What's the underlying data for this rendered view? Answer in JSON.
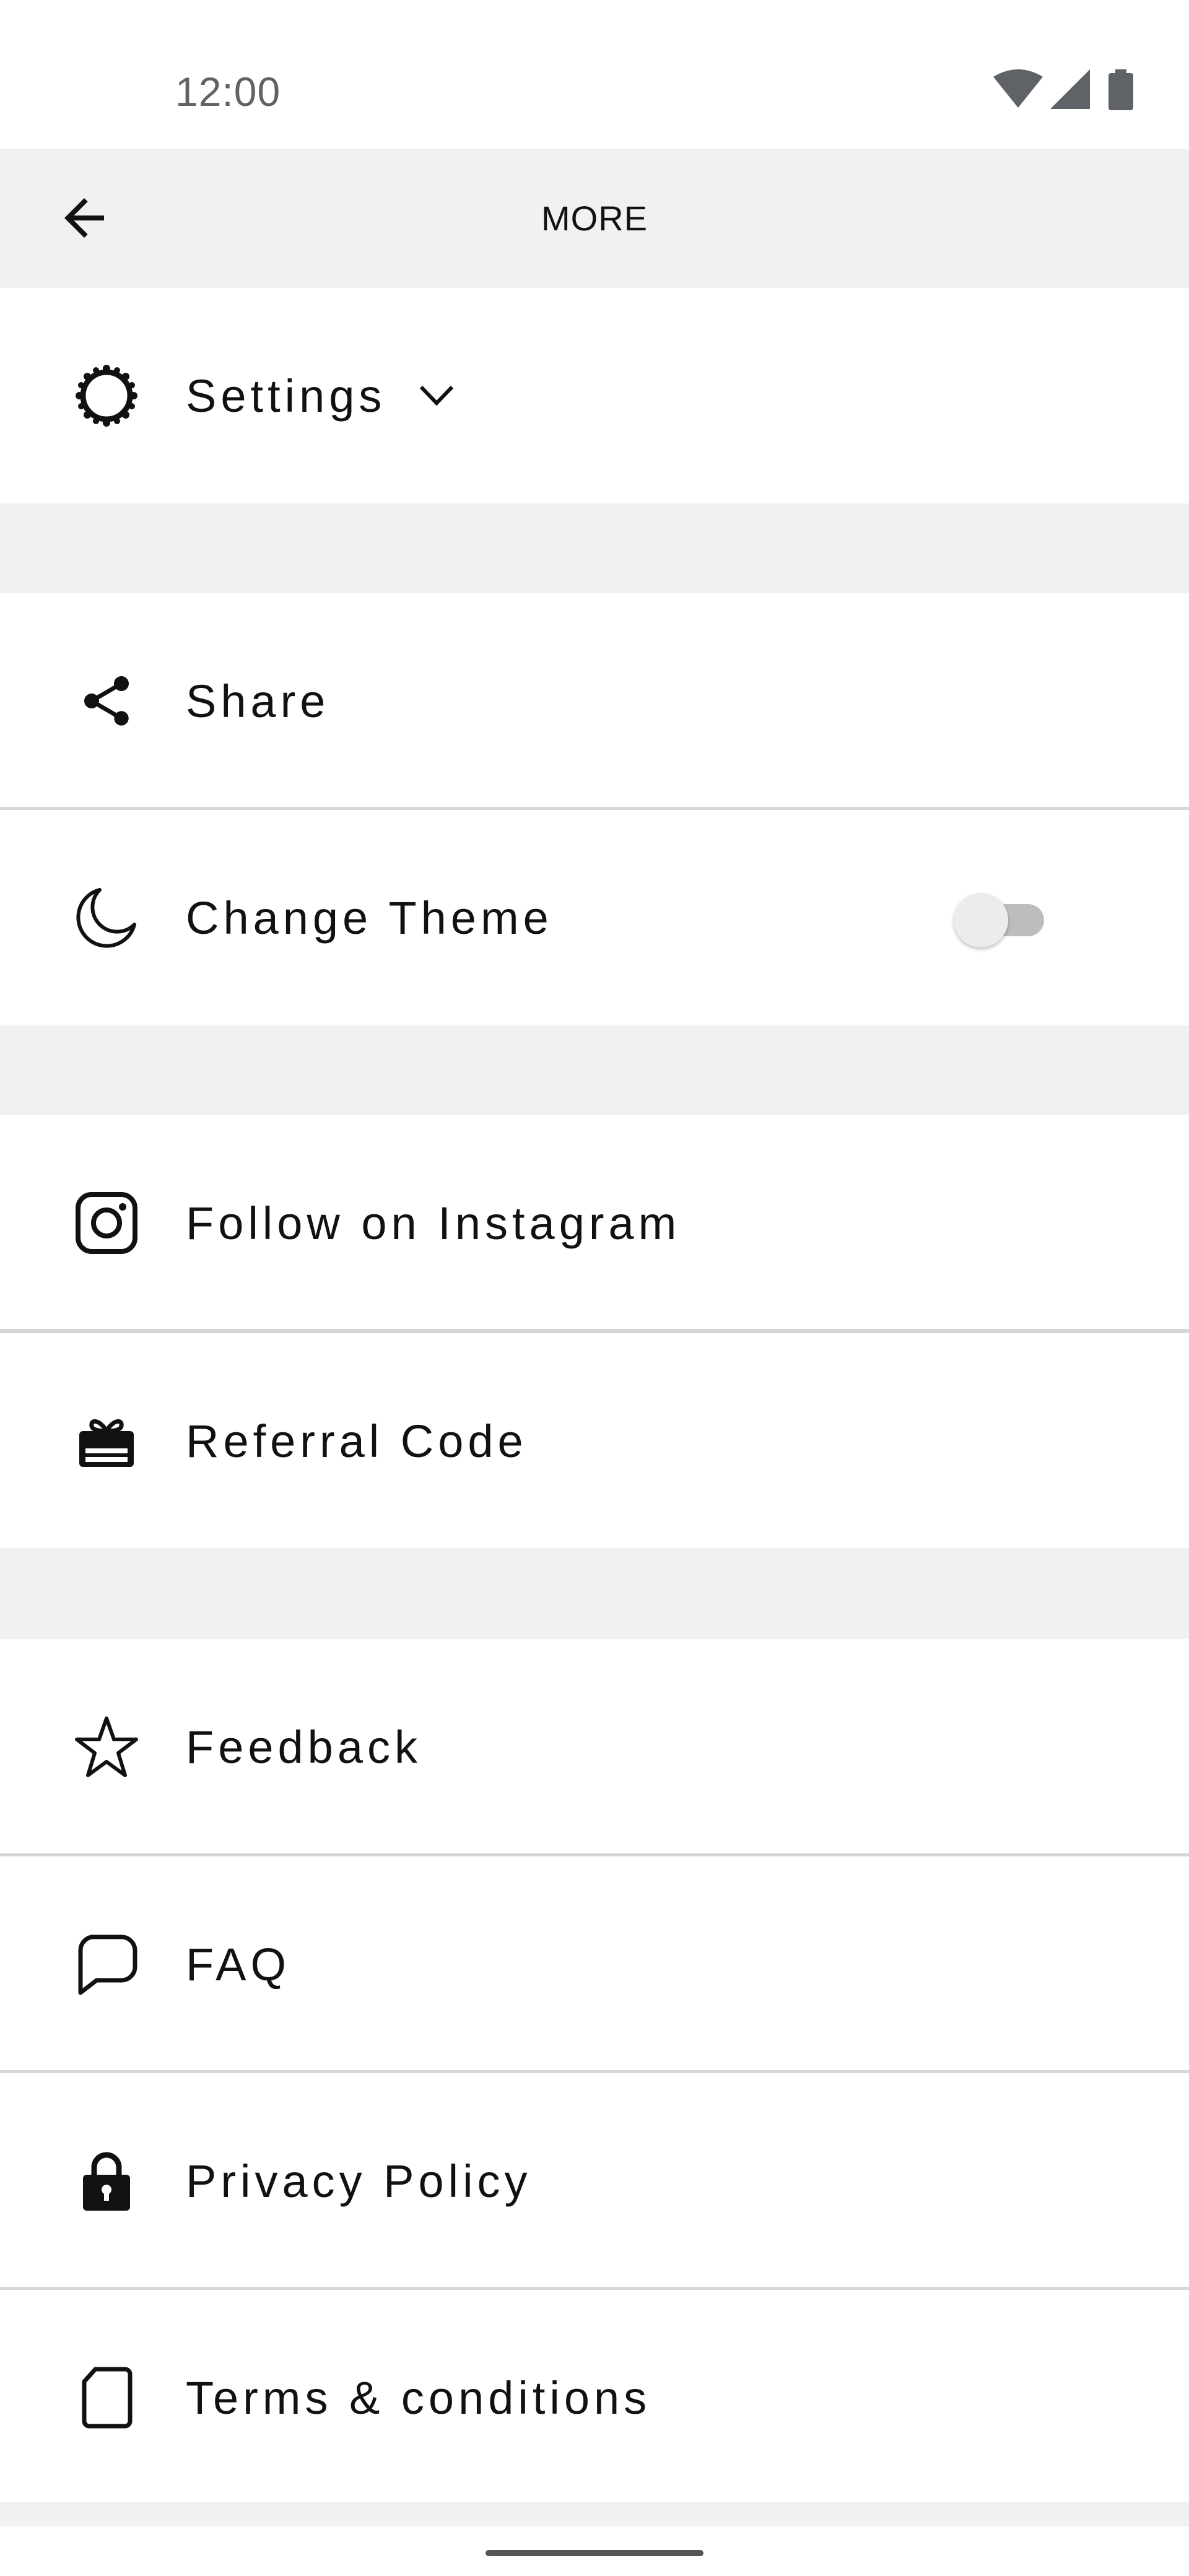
{
  "status_bar": {
    "time": "12:00",
    "icons": [
      "wifi-icon",
      "cellular-signal-icon",
      "battery-icon"
    ]
  },
  "app_bar": {
    "back_icon": "arrow-back-icon",
    "title": "MORE"
  },
  "menu": {
    "settings": {
      "label": "Settings",
      "icon": "gear-icon",
      "expand_icon": "chevron-down-icon"
    },
    "share": {
      "label": "Share",
      "icon": "share-icon"
    },
    "change_theme": {
      "label": "Change Theme",
      "icon": "moon-icon",
      "toggle_on": false
    },
    "instagram": {
      "label": "Follow on Instagram",
      "icon": "instagram-icon"
    },
    "referral": {
      "label": "Referral Code",
      "icon": "gift-card-icon"
    },
    "feedback": {
      "label": "Feedback",
      "icon": "star-icon"
    },
    "faq": {
      "label": "FAQ",
      "icon": "chat-bubble-icon"
    },
    "privacy": {
      "label": "Privacy Policy",
      "icon": "lock-icon"
    },
    "terms": {
      "label": "Terms & conditions",
      "icon": "document-icon"
    }
  },
  "colors": {
    "background": "#ffffff",
    "section_gap": "#f1f1f1",
    "divider": "#d6d6d6",
    "text": "#111111",
    "status_text": "#5f6368"
  }
}
